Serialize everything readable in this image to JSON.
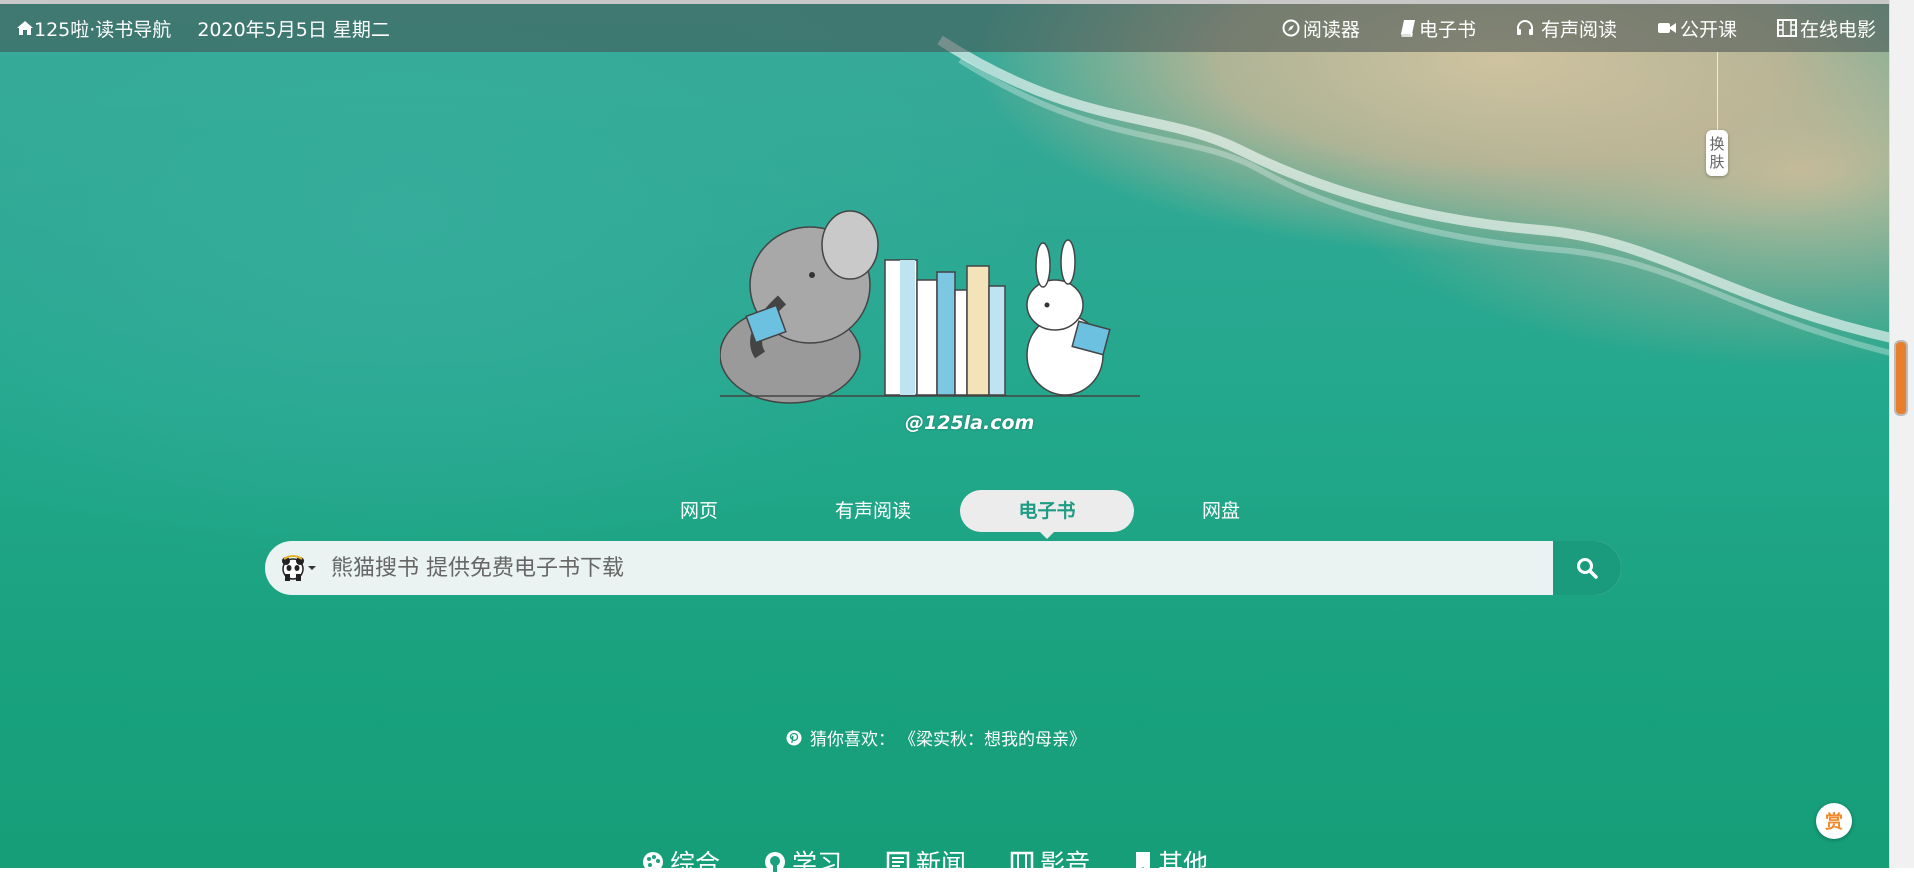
{
  "topbar": {
    "site_title": "125啦·读书导航",
    "date": "2020年5月5日 星期二",
    "nav": [
      {
        "label": "阅读器",
        "icon": "compass-icon"
      },
      {
        "label": "电子书",
        "icon": "book-icon"
      },
      {
        "label": "有声阅读",
        "icon": "headphones-icon"
      },
      {
        "label": "公开课",
        "icon": "video-camera-icon"
      },
      {
        "label": "在线电影",
        "icon": "film-icon"
      }
    ]
  },
  "skin_button": {
    "line1": "换",
    "line2": "肤"
  },
  "logo": {
    "credit": "@125la.com"
  },
  "search_tabs": [
    {
      "label": "网页",
      "active": false
    },
    {
      "label": "有声阅读",
      "active": false
    },
    {
      "label": "电子书",
      "active": true
    },
    {
      "label": "网盘",
      "active": false
    }
  ],
  "search": {
    "placeholder": "熊猫搜书 提供免费电子书下载",
    "engine_icon": "panda-icon",
    "button_icon": "search-icon"
  },
  "guess": {
    "label": "猜你喜欢：",
    "book": "《梁实秋：想我的母亲》"
  },
  "categories": [
    {
      "label": "综合",
      "icon": "palette-icon"
    },
    {
      "label": "学习",
      "icon": "github-icon"
    },
    {
      "label": "新闻",
      "icon": "newspaper-icon"
    },
    {
      "label": "影音",
      "icon": "film-icon"
    },
    {
      "label": "其他",
      "icon": "bookmark-icon"
    }
  ],
  "reward": {
    "label": "赏"
  },
  "colors": {
    "accent": "#1a9b7e",
    "active_tab_text": "#1e9b84",
    "scroll_thumb": "#e87f2c",
    "reward_text": "#f08a2b"
  }
}
